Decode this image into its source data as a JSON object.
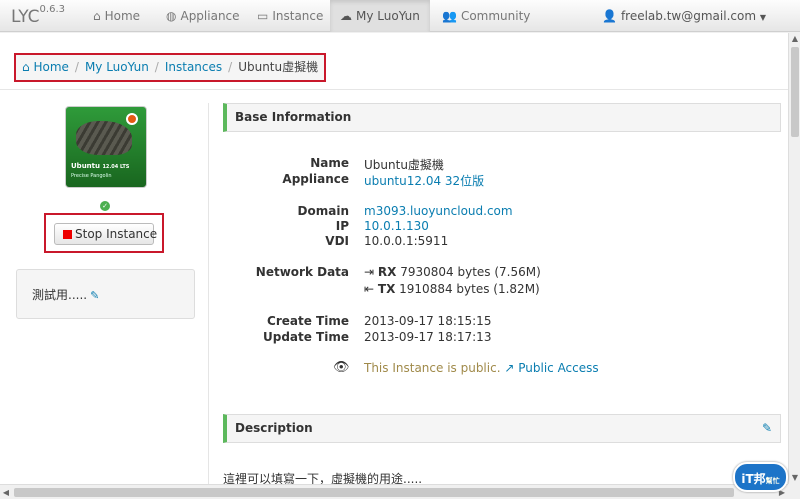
{
  "brand": {
    "name": "LYC",
    "version": "0.6.3"
  },
  "nav": {
    "home": {
      "label": "Home",
      "icon": "home-icon"
    },
    "appliance": {
      "label": "Appliance",
      "icon": "globe-icon"
    },
    "instance": {
      "label": "Instance",
      "icon": "hdd-icon"
    },
    "myluoyun": {
      "label": "My LuoYun",
      "icon": "cloud-icon"
    },
    "community": {
      "label": "Community",
      "icon": "users-icon"
    },
    "user": {
      "email": "freelab.tw@gmail.com",
      "icon": "user-icon"
    }
  },
  "breadcrumb": {
    "home": "Home",
    "myluoyun": "My LuoYun",
    "instances": "Instances",
    "current": "Ubuntu虛擬機"
  },
  "instance": {
    "thumb_title": "Ubuntu",
    "thumb_version": "12.04 LTS",
    "thumb_subtitle": "Precise Pangolin",
    "status_icon": "ok-circle-icon",
    "stop_label": "Stop Instance",
    "note": "測試用....."
  },
  "base_info": {
    "title": "Base Information",
    "labels": {
      "name": "Name",
      "appliance": "Appliance",
      "domain": "Domain",
      "ip": "IP",
      "vdi": "VDI",
      "network": "Network Data",
      "create": "Create Time",
      "update": "Update Time"
    },
    "values": {
      "name": "Ubuntu虛擬機",
      "appliance": "ubuntu12.04 32位版",
      "domain": "m3093.luoyuncloud.com",
      "ip": "10.0.1.130",
      "vdi": "10.0.0.1:5911",
      "rx_label": "RX",
      "rx_value": "7930804 bytes (7.56M)",
      "tx_label": "TX",
      "tx_value": "1910884 bytes (1.82M)",
      "create": "2013-09-17 18:15:15",
      "update": "2013-09-17 18:17:13",
      "public_text": "This Instance is public.",
      "public_link": "Public Access"
    }
  },
  "description": {
    "title": "Description",
    "text": "這裡可以填寫一下，虛擬機的用途....."
  },
  "watermark": {
    "main": "iT邦",
    "sub": "幫忙"
  }
}
